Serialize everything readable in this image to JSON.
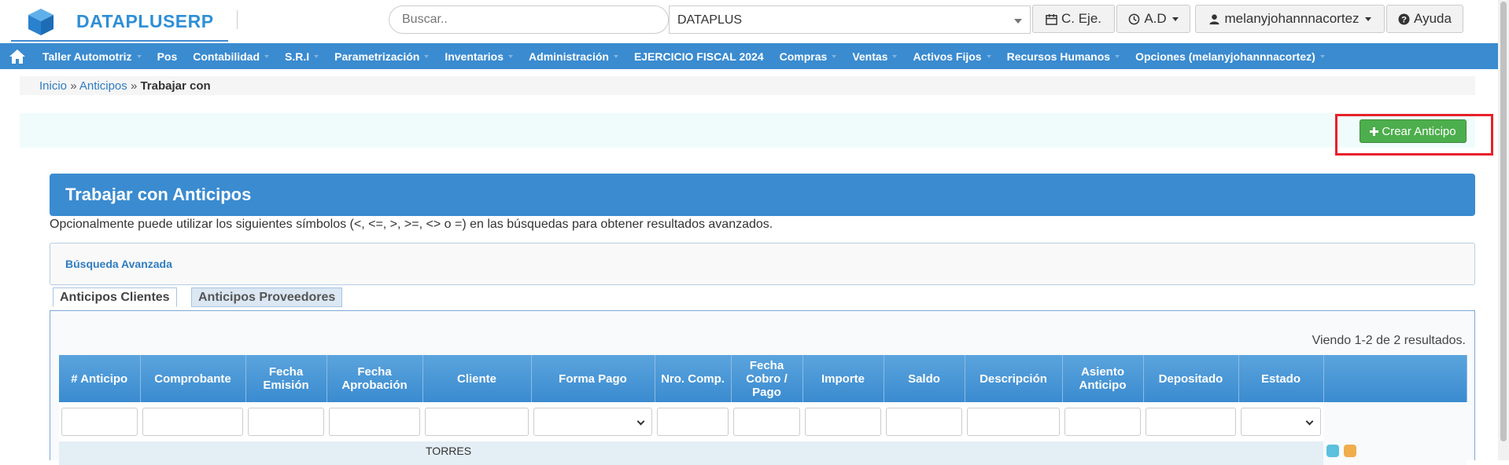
{
  "header": {
    "brand": "DATAPLUSERP",
    "search_placeholder": "Buscar..",
    "company": "DATAPLUS",
    "btn_period": "C. Eje.",
    "btn_ad": "A.D",
    "btn_user": "melanyjohannnacortez",
    "btn_help": "Ayuda"
  },
  "nav": {
    "items": [
      {
        "label": "Taller Automotriz",
        "dropdown": true
      },
      {
        "label": "Pos",
        "dropdown": false
      },
      {
        "label": "Contabilidad",
        "dropdown": true
      },
      {
        "label": "S.R.I",
        "dropdown": true
      },
      {
        "label": "Parametrización",
        "dropdown": true
      },
      {
        "label": "Inventarios",
        "dropdown": true
      },
      {
        "label": "Administración",
        "dropdown": true
      },
      {
        "label": "EJERCICIO FISCAL 2024",
        "dropdown": false
      },
      {
        "label": "Compras",
        "dropdown": true
      },
      {
        "label": "Ventas",
        "dropdown": true
      },
      {
        "label": "Activos Fijos",
        "dropdown": true
      },
      {
        "label": "Recursos Humanos",
        "dropdown": true
      },
      {
        "label": "Opciones (melanyjohannnacortez)",
        "dropdown": true
      }
    ]
  },
  "breadcrumb": {
    "home": "Inicio",
    "sep": "»",
    "section": "Anticipos",
    "current": "Trabajar con"
  },
  "actions": {
    "create_label": "Crear Anticipo"
  },
  "panel": {
    "title": "Trabajar con Anticipos",
    "hint": "Opcionalmente puede utilizar los siguientes símbolos (<, <=, >, >=, <> o =) en las búsquedas para obtener resultados avanzados.",
    "advanced_search": "Búsqueda Avanzada"
  },
  "tabs": [
    {
      "label": "Anticipos Clientes",
      "active": true
    },
    {
      "label": "Anticipos Proveedores",
      "active": false
    }
  ],
  "grid": {
    "summary": "Viendo 1-2 de 2 resultados.",
    "columns": [
      "# Anticipo",
      "Comprobante",
      "Fecha Emisión",
      "Fecha Aprobación",
      "Cliente",
      "Forma Pago",
      "Nro. Comp.",
      "Fecha Cobro / Pago",
      "Importe",
      "Saldo",
      "Descripción",
      "Asiento Anticipo",
      "Depositado",
      "Estado",
      ""
    ],
    "first_row_partial": {
      "cliente": "TORRES"
    }
  },
  "colors": {
    "brand": "#2f8fd6",
    "nav": "#3a8bd0",
    "create_button": "#4cae4c",
    "highlight": "#e8202a"
  }
}
